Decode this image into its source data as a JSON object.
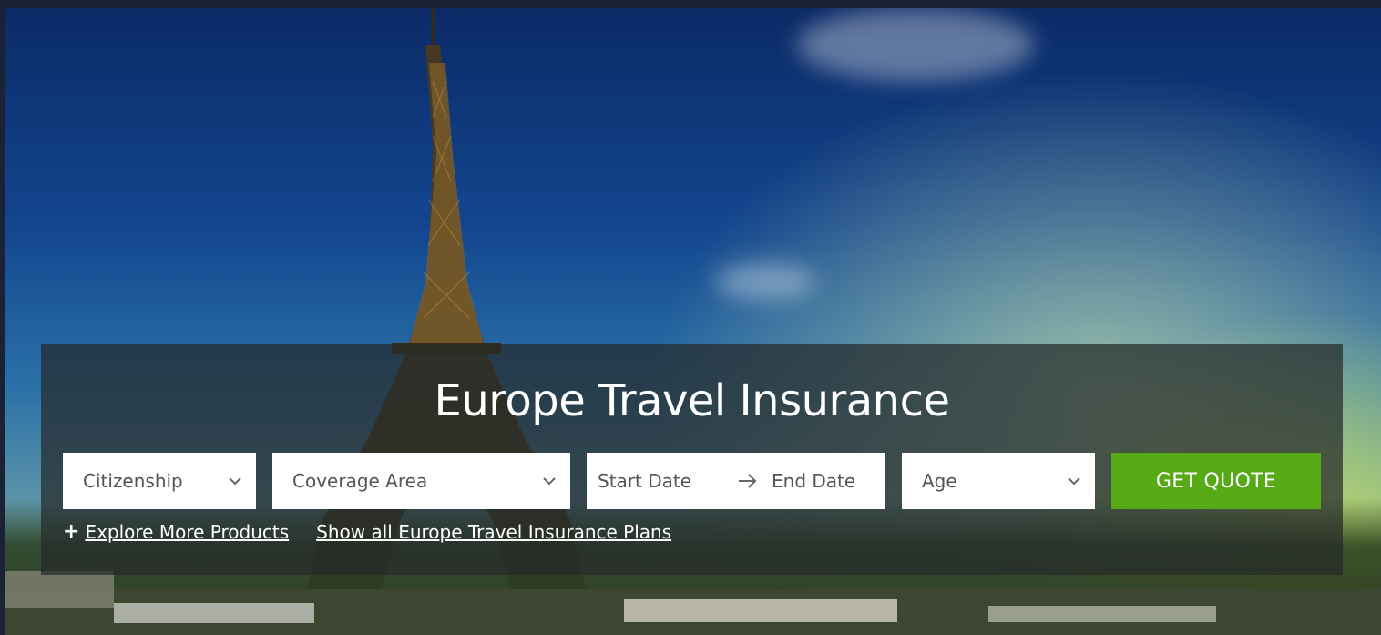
{
  "hero": {
    "title": "Europe Travel Insurance"
  },
  "form": {
    "citizenship_label": "Citizenship",
    "coverage_label": "Coverage Area",
    "start_date_label": "Start Date",
    "end_date_label": "End Date",
    "age_label": "Age",
    "submit_label": "GET QUOTE"
  },
  "links": {
    "explore_label": "Explore More Products",
    "show_all_label": "Show all Europe Travel Insurance Plans"
  },
  "colors": {
    "button_green": "#55aa16",
    "panel_overlay": "#262a2a"
  },
  "icons": {
    "dropdown": "chevron-down-icon",
    "date_arrow": "arrow-right-icon",
    "explore": "plus-icon"
  }
}
